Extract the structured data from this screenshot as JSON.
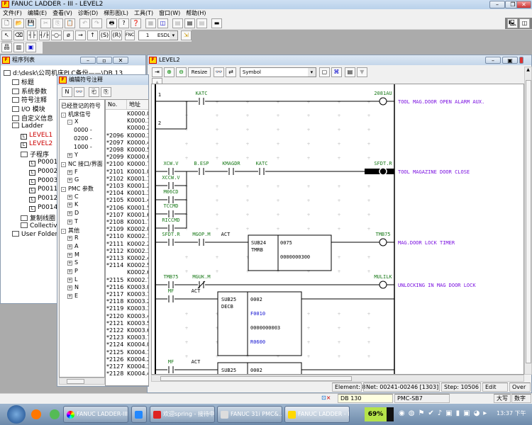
{
  "app": {
    "title": "FANUC LADDER - III - LEVEL2"
  },
  "menu": [
    "文件(F)",
    "编辑(E)",
    "查看(V)",
    "诊断(D)",
    "梯形图(L)",
    "工具(T)",
    "窗口(W)",
    "帮助(H)"
  ],
  "toolbar2": {
    "fnc_label": "FNC",
    "fnc_number": "1",
    "fnc_name": "ESDL"
  },
  "program_list": {
    "title": "程序列表",
    "items": [
      {
        "label": "d:\\desk\\公司机床PLC备份——\\DB 13",
        "icon": "folder",
        "level": 0
      },
      {
        "label": "标题",
        "icon": "folder",
        "level": 1
      },
      {
        "label": "系统参数",
        "icon": "folder",
        "level": 1
      },
      {
        "label": "符号注释",
        "icon": "folder",
        "level": 1
      },
      {
        "label": "I/O 模块",
        "icon": "folder",
        "level": 1
      },
      {
        "label": "自定义信息",
        "icon": "folder",
        "level": 1
      },
      {
        "label": "Ladder",
        "icon": "folder",
        "level": 1
      },
      {
        "label": "LEVEL1",
        "icon": "ladder",
        "level": 2,
        "red": true
      },
      {
        "label": "LEVEL2",
        "icon": "ladder",
        "level": 2,
        "red": true
      },
      {
        "label": "子程序",
        "icon": "folder",
        "level": 2
      },
      {
        "label": "P0001",
        "icon": "ladder",
        "level": 3
      },
      {
        "label": "P0002",
        "icon": "ladder",
        "level": 3
      },
      {
        "label": "P0003",
        "icon": "ladder",
        "level": 3
      },
      {
        "label": "P0011",
        "icon": "ladder",
        "level": 3
      },
      {
        "label": "P0012",
        "icon": "ladder",
        "level": 3
      },
      {
        "label": "P0014",
        "icon": "ladder",
        "level": 3
      },
      {
        "label": "复制线圈",
        "icon": "folder",
        "level": 2
      },
      {
        "label": "Collective",
        "icon": "folder",
        "level": 2
      },
      {
        "label": "User Folder",
        "icon": "folder",
        "level": 1
      }
    ]
  },
  "symbol_editor": {
    "title": "编辑符号注释",
    "tree": [
      {
        "label": "已经登记的符号",
        "level": 0
      },
      {
        "label": "机床信号",
        "level": 0,
        "pm": "-"
      },
      {
        "label": "X",
        "level": 1,
        "pm": "-"
      },
      {
        "label": "0000 -",
        "level": 2
      },
      {
        "label": "0200 -",
        "level": 2
      },
      {
        "label": "1000 -",
        "level": 2
      },
      {
        "label": "Y",
        "level": 1,
        "pm": "+"
      },
      {
        "label": "NC 接口/界面",
        "level": 0,
        "pm": "-"
      },
      {
        "label": "F",
        "level": 1,
        "pm": "+"
      },
      {
        "label": "G",
        "level": 1,
        "pm": "+"
      },
      {
        "label": "PMC 参数",
        "level": 0,
        "pm": "-"
      },
      {
        "label": "C",
        "level": 1,
        "pm": "+"
      },
      {
        "label": "K",
        "level": 1,
        "pm": "+"
      },
      {
        "label": "D",
        "level": 1,
        "pm": "+"
      },
      {
        "label": "T",
        "level": 1,
        "pm": "+"
      },
      {
        "label": "其他",
        "level": 0,
        "pm": "-"
      },
      {
        "label": "R",
        "level": 1,
        "pm": "+"
      },
      {
        "label": "A",
        "level": 1,
        "pm": "+"
      },
      {
        "label": "M",
        "level": 1,
        "pm": "+"
      },
      {
        "label": "S",
        "level": 1,
        "pm": "+"
      },
      {
        "label": "P",
        "level": 1,
        "pm": "+"
      },
      {
        "label": "L",
        "level": 1,
        "pm": "+"
      },
      {
        "label": "N",
        "level": 1,
        "pm": "+"
      },
      {
        "label": "E",
        "level": 1,
        "pm": "+"
      }
    ],
    "columns": [
      "No.",
      "地址"
    ],
    "rows": [
      [
        "",
        "K0000.0"
      ],
      [
        "",
        "K0000.1"
      ],
      [
        "",
        "K0000.2"
      ],
      [
        "*2096",
        "K0000.3"
      ],
      [
        "*2097",
        "K0000.4"
      ],
      [
        "*2098",
        "K0000.5"
      ],
      [
        "*2099",
        "K0000.6"
      ],
      [
        "*2100",
        "K0000.7"
      ],
      [
        "*2101",
        "K0001.0"
      ],
      [
        "*2102",
        "K0001.1"
      ],
      [
        "*2103",
        "K0001.2"
      ],
      [
        "*2104",
        "K0001.3"
      ],
      [
        "*2105",
        "K0001.4"
      ],
      [
        "*2106",
        "K0001.5"
      ],
      [
        "*2107",
        "K0001.6"
      ],
      [
        "*2108",
        "K0001.7"
      ],
      [
        "*2109",
        "K0002.0"
      ],
      [
        "*2110",
        "K0002.1"
      ],
      [
        "*2111",
        "K0002.2"
      ],
      [
        "*2112",
        "K0002.3"
      ],
      [
        "*2113",
        "K0002.4"
      ],
      [
        "*2114",
        "K0002.5"
      ],
      [
        "",
        "K0002.6"
      ],
      [
        "*2115",
        "K0002.7"
      ],
      [
        "*2116",
        "K0003.0"
      ],
      [
        "*2117",
        "K0003.1"
      ],
      [
        "*2118",
        "K0003.2"
      ],
      [
        "*2119",
        "K0003.3"
      ],
      [
        "*2120",
        "K0003.4"
      ],
      [
        "*2121",
        "K0003.5"
      ],
      [
        "*2122",
        "K0003.6"
      ],
      [
        "*2123",
        "K0003.7"
      ],
      [
        "*2124",
        "K0004.0"
      ],
      [
        "*2125",
        "K0004.1"
      ],
      [
        "*2126",
        "K0004.2"
      ],
      [
        "*2127",
        "K0004.3"
      ],
      [
        "*2128",
        "K0004.4"
      ]
    ]
  },
  "ladder_window": {
    "title": "LEVEL2",
    "resize_label": "Resize",
    "display_mode": "Symbol"
  },
  "ladder": {
    "rung_numbers": [
      "1",
      "2"
    ],
    "rung1": {
      "contact": "KATC",
      "coil": "2081AU",
      "comment": "TOOL MAG.DOOR OPEN ALARM AUX."
    },
    "rung2": {
      "contacts": [
        "XCW.V",
        "B.ESP",
        "KMAGDR",
        "KATC"
      ],
      "branches": [
        "XCCW.V",
        "M06CD",
        "TCCMD",
        "RICCMD"
      ],
      "coil": "SFDT.R",
      "comment": "TOOL MAGAZINE DOOR CLOSE"
    },
    "rung3": {
      "contacts": [
        "SFDT.R",
        "MGOP.M"
      ],
      "act": "ACT",
      "func": "SUB24",
      "func_name": "TMRB",
      "params": [
        "0075",
        "0000000300"
      ],
      "coil": "TMB75",
      "comment": "MAG.DOOR LOCK TIMER"
    },
    "rung4": {
      "contacts": [
        "TMB75",
        "MGUK.M"
      ],
      "coil": "MULILK",
      "comment": "UNLOCKING IN MAG DOOR LOCK"
    },
    "rung5": {
      "contact": "MF",
      "act": "ACT",
      "func": "SUB25",
      "func_name": "DECB",
      "params": [
        "0002",
        "F0010",
        "0000000003",
        "R0600"
      ]
    },
    "rung6": {
      "contact": "MF",
      "act": "ACT",
      "func": "SUB25",
      "params": [
        "0002"
      ]
    }
  },
  "ladder_status": {
    "element": "Element: 8",
    "net": "Net: 00241-00246 [1303]",
    "step": "Step: 10506",
    "mode": "Edit",
    "insert": "Over"
  },
  "app_status": {
    "db": "DB 130",
    "pmc": "PMC-SB7",
    "caps": "大写",
    "num": "数字"
  },
  "taskbar": {
    "items": [
      "FANUC LADDER-III...",
      "欢迎spring - 接待中...",
      "FANUC 31i PMC&...",
      "FANUC LADDER - I..."
    ],
    "battery": "69%",
    "clock": "13:37 下午"
  },
  "colors": {
    "contact_label": "#1a7a1a",
    "comment": "#7a10e0",
    "address_param": "#1010d0"
  }
}
